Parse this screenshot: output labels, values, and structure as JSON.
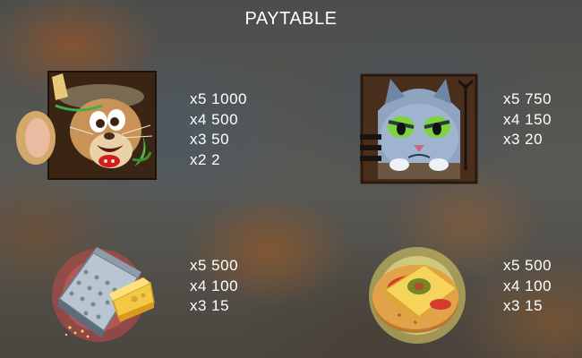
{
  "title": "PAYTABLE",
  "symbols": [
    {
      "name": "mouse",
      "pays": [
        "x5 1000",
        "x4 500",
        "x3 50",
        "x2 2"
      ]
    },
    {
      "name": "cat",
      "pays": [
        "x5 750",
        "x4 150",
        "x3 20"
      ]
    },
    {
      "name": "cheese-grater",
      "pays": [
        "x5 500",
        "x4 100",
        "x3 15"
      ]
    },
    {
      "name": "cracker-with-cheese",
      "pays": [
        "x5 500",
        "x4 100",
        "x3 15"
      ]
    }
  ]
}
